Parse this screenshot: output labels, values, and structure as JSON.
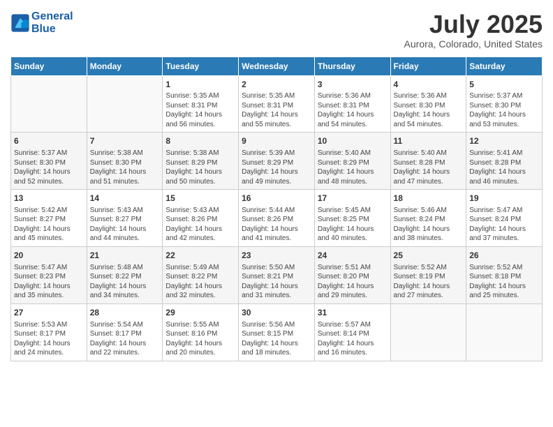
{
  "header": {
    "logo_line1": "General",
    "logo_line2": "Blue",
    "month_year": "July 2025",
    "location": "Aurora, Colorado, United States"
  },
  "weekdays": [
    "Sunday",
    "Monday",
    "Tuesday",
    "Wednesday",
    "Thursday",
    "Friday",
    "Saturday"
  ],
  "weeks": [
    [
      {
        "day": "",
        "info": ""
      },
      {
        "day": "",
        "info": ""
      },
      {
        "day": "1",
        "info": "Sunrise: 5:35 AM\nSunset: 8:31 PM\nDaylight: 14 hours and 56 minutes."
      },
      {
        "day": "2",
        "info": "Sunrise: 5:35 AM\nSunset: 8:31 PM\nDaylight: 14 hours and 55 minutes."
      },
      {
        "day": "3",
        "info": "Sunrise: 5:36 AM\nSunset: 8:31 PM\nDaylight: 14 hours and 54 minutes."
      },
      {
        "day": "4",
        "info": "Sunrise: 5:36 AM\nSunset: 8:30 PM\nDaylight: 14 hours and 54 minutes."
      },
      {
        "day": "5",
        "info": "Sunrise: 5:37 AM\nSunset: 8:30 PM\nDaylight: 14 hours and 53 minutes."
      }
    ],
    [
      {
        "day": "6",
        "info": "Sunrise: 5:37 AM\nSunset: 8:30 PM\nDaylight: 14 hours and 52 minutes."
      },
      {
        "day": "7",
        "info": "Sunrise: 5:38 AM\nSunset: 8:30 PM\nDaylight: 14 hours and 51 minutes."
      },
      {
        "day": "8",
        "info": "Sunrise: 5:38 AM\nSunset: 8:29 PM\nDaylight: 14 hours and 50 minutes."
      },
      {
        "day": "9",
        "info": "Sunrise: 5:39 AM\nSunset: 8:29 PM\nDaylight: 14 hours and 49 minutes."
      },
      {
        "day": "10",
        "info": "Sunrise: 5:40 AM\nSunset: 8:29 PM\nDaylight: 14 hours and 48 minutes."
      },
      {
        "day": "11",
        "info": "Sunrise: 5:40 AM\nSunset: 8:28 PM\nDaylight: 14 hours and 47 minutes."
      },
      {
        "day": "12",
        "info": "Sunrise: 5:41 AM\nSunset: 8:28 PM\nDaylight: 14 hours and 46 minutes."
      }
    ],
    [
      {
        "day": "13",
        "info": "Sunrise: 5:42 AM\nSunset: 8:27 PM\nDaylight: 14 hours and 45 minutes."
      },
      {
        "day": "14",
        "info": "Sunrise: 5:43 AM\nSunset: 8:27 PM\nDaylight: 14 hours and 44 minutes."
      },
      {
        "day": "15",
        "info": "Sunrise: 5:43 AM\nSunset: 8:26 PM\nDaylight: 14 hours and 42 minutes."
      },
      {
        "day": "16",
        "info": "Sunrise: 5:44 AM\nSunset: 8:26 PM\nDaylight: 14 hours and 41 minutes."
      },
      {
        "day": "17",
        "info": "Sunrise: 5:45 AM\nSunset: 8:25 PM\nDaylight: 14 hours and 40 minutes."
      },
      {
        "day": "18",
        "info": "Sunrise: 5:46 AM\nSunset: 8:24 PM\nDaylight: 14 hours and 38 minutes."
      },
      {
        "day": "19",
        "info": "Sunrise: 5:47 AM\nSunset: 8:24 PM\nDaylight: 14 hours and 37 minutes."
      }
    ],
    [
      {
        "day": "20",
        "info": "Sunrise: 5:47 AM\nSunset: 8:23 PM\nDaylight: 14 hours and 35 minutes."
      },
      {
        "day": "21",
        "info": "Sunrise: 5:48 AM\nSunset: 8:22 PM\nDaylight: 14 hours and 34 minutes."
      },
      {
        "day": "22",
        "info": "Sunrise: 5:49 AM\nSunset: 8:22 PM\nDaylight: 14 hours and 32 minutes."
      },
      {
        "day": "23",
        "info": "Sunrise: 5:50 AM\nSunset: 8:21 PM\nDaylight: 14 hours and 31 minutes."
      },
      {
        "day": "24",
        "info": "Sunrise: 5:51 AM\nSunset: 8:20 PM\nDaylight: 14 hours and 29 minutes."
      },
      {
        "day": "25",
        "info": "Sunrise: 5:52 AM\nSunset: 8:19 PM\nDaylight: 14 hours and 27 minutes."
      },
      {
        "day": "26",
        "info": "Sunrise: 5:52 AM\nSunset: 8:18 PM\nDaylight: 14 hours and 25 minutes."
      }
    ],
    [
      {
        "day": "27",
        "info": "Sunrise: 5:53 AM\nSunset: 8:17 PM\nDaylight: 14 hours and 24 minutes."
      },
      {
        "day": "28",
        "info": "Sunrise: 5:54 AM\nSunset: 8:17 PM\nDaylight: 14 hours and 22 minutes."
      },
      {
        "day": "29",
        "info": "Sunrise: 5:55 AM\nSunset: 8:16 PM\nDaylight: 14 hours and 20 minutes."
      },
      {
        "day": "30",
        "info": "Sunrise: 5:56 AM\nSunset: 8:15 PM\nDaylight: 14 hours and 18 minutes."
      },
      {
        "day": "31",
        "info": "Sunrise: 5:57 AM\nSunset: 8:14 PM\nDaylight: 14 hours and 16 minutes."
      },
      {
        "day": "",
        "info": ""
      },
      {
        "day": "",
        "info": ""
      }
    ]
  ]
}
